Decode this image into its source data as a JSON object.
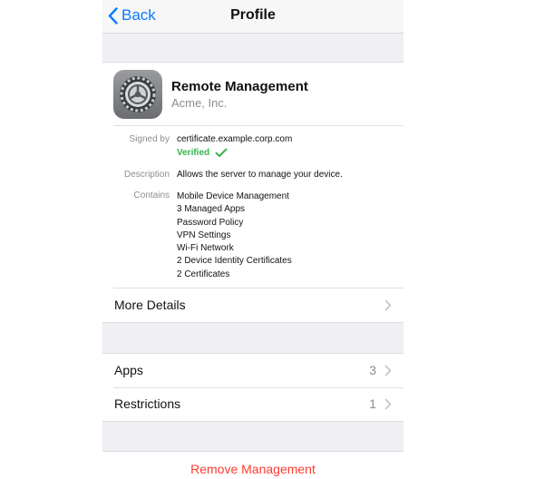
{
  "nav": {
    "back_label": "Back",
    "title": "Profile"
  },
  "profile": {
    "icon": "settings-gear-icon",
    "name": "Remote Management",
    "organization": "Acme, Inc.",
    "signed_by_label": "Signed by",
    "signed_by_value": "certificate.example.corp.com",
    "verified_label": "Verified",
    "description_label": "Description",
    "description_value": "Allows the server to manage your device.",
    "contains_label": "Contains",
    "contains": [
      "Mobile Device Management",
      "3 Managed Apps",
      "Password Policy",
      "VPN Settings",
      "Wi-Fi Network",
      "2 Device Identity Certificates",
      "2 Certificates"
    ],
    "more_details_label": "More Details"
  },
  "sections": {
    "apps_label": "Apps",
    "apps_count": "3",
    "restrictions_label": "Restrictions",
    "restrictions_count": "1"
  },
  "actions": {
    "remove_label": "Remove Management"
  },
  "colors": {
    "accent": "#0a7aff",
    "verified": "#34b44a",
    "destructive": "#ff3b30",
    "background": "#efeff4"
  }
}
